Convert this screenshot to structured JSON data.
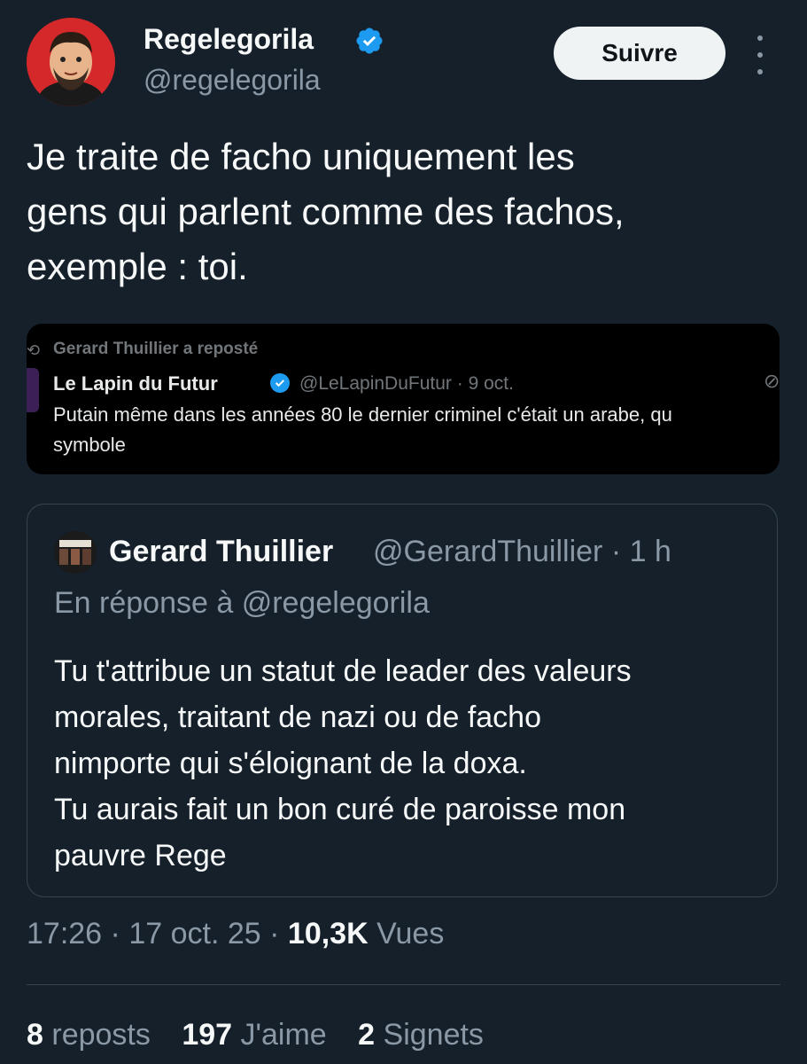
{
  "author": {
    "name": "Regelegorila",
    "handle": "@regelegorila",
    "verified": true
  },
  "actions": {
    "follow_label": "Suivre"
  },
  "tweet": {
    "text": "Je traite de facho uniquement les\ngens qui parlent comme des fachos,\nexemple : toi."
  },
  "media_screenshot": {
    "repost_line": "Gerard Thuillier a reposté",
    "name": "Le Lapin du Futur",
    "handle_time": "@LeLapinDuFutur · 9 oct.",
    "text_line1": "Putain même dans les années 80 le dernier criminel c'était un arabe, qu",
    "text_line2": "symbole"
  },
  "quote": {
    "name": "Gerard Thuillier",
    "handle": "@GerardThuillier",
    "sep": "·",
    "time": "1 h",
    "reply_to": "En réponse à @regelegorila",
    "text": "Tu t'attribue un statut de leader des valeurs\nmorales, traitant de nazi ou de facho\nnimporte qui s'éloignant de la doxa.\nTu aurais fait un bon curé de paroisse mon\npauvre Rege"
  },
  "meta": {
    "time": "17:26",
    "date": "17 oct. 25",
    "sep": "·",
    "views_count": "10,3K",
    "views_label": "Vues"
  },
  "stats": {
    "reposts_count": "8",
    "reposts_label": "reposts",
    "likes_count": "197",
    "likes_label": "J'aime",
    "bookmarks_count": "2",
    "bookmarks_label": "Signets"
  },
  "colors": {
    "background": "#15202b",
    "text": "#f7f9f9",
    "secondary": "#8b98a5",
    "verified": "#1d9bf0",
    "border": "#38444d"
  }
}
